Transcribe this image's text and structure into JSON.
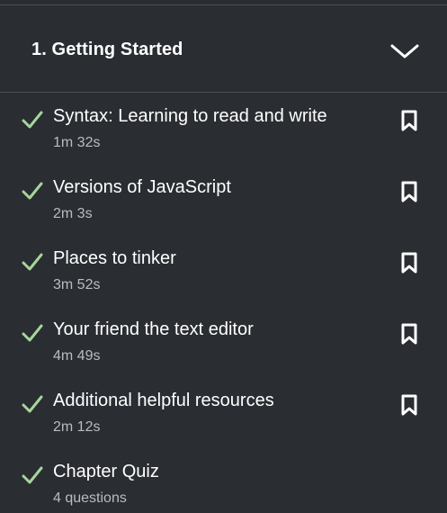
{
  "chapter": {
    "title": "1. Getting Started",
    "expanded": true
  },
  "colors": {
    "background": "#2a2d32",
    "divider": "#4b4f56",
    "check": "#a7d59b",
    "meta_text": "#b9bcc1"
  },
  "lessons": [
    {
      "title": "Syntax: Learning to read and write",
      "meta": "1m 32s",
      "completed": true,
      "bookmark_icon": "bookmark-icon"
    },
    {
      "title": "Versions of JavaScript",
      "meta": "2m 3s",
      "completed": true,
      "bookmark_icon": "bookmark-icon"
    },
    {
      "title": "Places to tinker",
      "meta": "3m 52s",
      "completed": true,
      "bookmark_icon": "bookmark-icon"
    },
    {
      "title": "Your friend the text editor",
      "meta": "4m 49s",
      "completed": true,
      "bookmark_icon": "bookmark-icon"
    },
    {
      "title": "Additional helpful resources",
      "meta": "2m 12s",
      "completed": true,
      "bookmark_icon": "bookmark-icon"
    },
    {
      "title": "Chapter Quiz",
      "meta": "4 questions",
      "completed": true
    }
  ]
}
